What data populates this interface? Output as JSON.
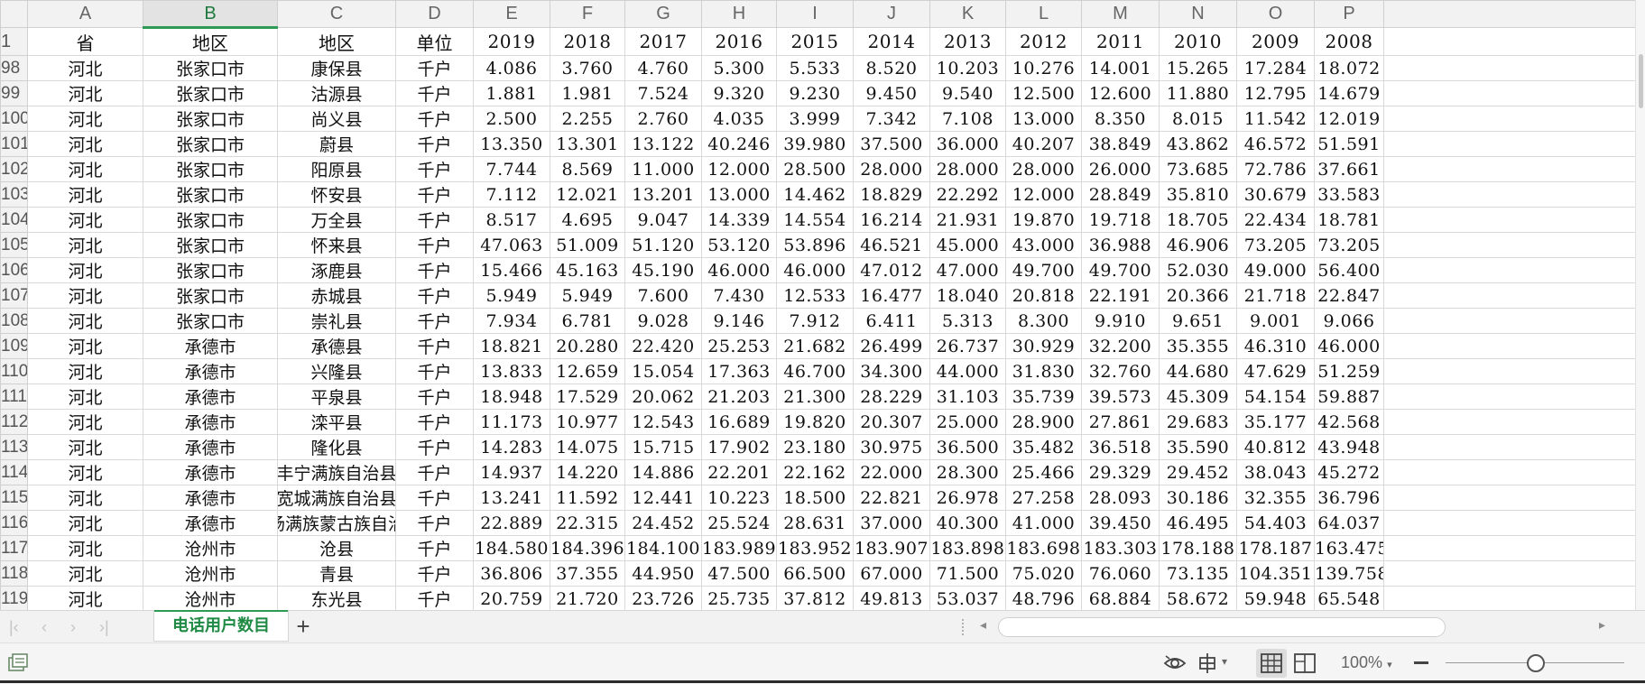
{
  "sheet": {
    "columns": [
      "A",
      "B",
      "C",
      "D",
      "E",
      "F",
      "G",
      "H",
      "I",
      "J",
      "K",
      "L",
      "M",
      "N",
      "O",
      "P"
    ],
    "active_column": "B",
    "header_row": {
      "row_number": "1",
      "cells": [
        "省",
        "地区",
        "地区",
        "单位",
        "2019",
        "2018",
        "2017",
        "2016",
        "2015",
        "2014",
        "2013",
        "2012",
        "2011",
        "2010",
        "2009",
        "2008"
      ]
    },
    "rows": [
      {
        "n": "98",
        "cells": [
          "河北",
          "张家口市",
          "康保县",
          "千户",
          "4.086",
          "3.760",
          "4.760",
          "5.300",
          "5.533",
          "8.520",
          "10.203",
          "10.276",
          "14.001",
          "15.265",
          "17.284",
          "18.072"
        ]
      },
      {
        "n": "99",
        "cells": [
          "河北",
          "张家口市",
          "沽源县",
          "千户",
          "1.881",
          "1.981",
          "7.524",
          "9.320",
          "9.230",
          "9.450",
          "9.540",
          "12.500",
          "12.600",
          "11.880",
          "12.795",
          "14.679"
        ]
      },
      {
        "n": "100",
        "cells": [
          "河北",
          "张家口市",
          "尚义县",
          "千户",
          "2.500",
          "2.255",
          "2.760",
          "4.035",
          "3.999",
          "7.342",
          "7.108",
          "13.000",
          "8.350",
          "8.015",
          "11.542",
          "12.019"
        ]
      },
      {
        "n": "101",
        "cells": [
          "河北",
          "张家口市",
          "蔚县",
          "千户",
          "13.350",
          "13.301",
          "13.122",
          "40.246",
          "39.980",
          "37.500",
          "36.000",
          "40.207",
          "38.849",
          "43.862",
          "46.572",
          "51.591"
        ]
      },
      {
        "n": "102",
        "cells": [
          "河北",
          "张家口市",
          "阳原县",
          "千户",
          "7.744",
          "8.569",
          "11.000",
          "12.000",
          "28.500",
          "28.000",
          "28.000",
          "28.000",
          "26.000",
          "73.685",
          "72.786",
          "37.661"
        ]
      },
      {
        "n": "103",
        "cells": [
          "河北",
          "张家口市",
          "怀安县",
          "千户",
          "7.112",
          "12.021",
          "13.201",
          "13.000",
          "14.462",
          "18.829",
          "22.292",
          "12.000",
          "28.849",
          "35.810",
          "30.679",
          "33.583"
        ]
      },
      {
        "n": "104",
        "cells": [
          "河北",
          "张家口市",
          "万全县",
          "千户",
          "8.517",
          "4.695",
          "9.047",
          "14.339",
          "14.554",
          "16.214",
          "21.931",
          "19.870",
          "19.718",
          "18.705",
          "22.434",
          "18.781"
        ]
      },
      {
        "n": "105",
        "cells": [
          "河北",
          "张家口市",
          "怀来县",
          "千户",
          "47.063",
          "51.009",
          "51.120",
          "53.120",
          "53.896",
          "46.521",
          "45.000",
          "43.000",
          "36.988",
          "46.906",
          "73.205",
          "73.205"
        ]
      },
      {
        "n": "106",
        "cells": [
          "河北",
          "张家口市",
          "涿鹿县",
          "千户",
          "15.466",
          "45.163",
          "45.190",
          "46.000",
          "46.000",
          "47.012",
          "47.000",
          "49.700",
          "49.700",
          "52.030",
          "49.000",
          "56.400"
        ]
      },
      {
        "n": "107",
        "cells": [
          "河北",
          "张家口市",
          "赤城县",
          "千户",
          "5.949",
          "5.949",
          "7.600",
          "7.430",
          "12.533",
          "16.477",
          "18.040",
          "20.818",
          "22.191",
          "20.366",
          "21.718",
          "22.847"
        ]
      },
      {
        "n": "108",
        "cells": [
          "河北",
          "张家口市",
          "崇礼县",
          "千户",
          "7.934",
          "6.781",
          "9.028",
          "9.146",
          "7.912",
          "6.411",
          "5.313",
          "8.300",
          "9.910",
          "9.651",
          "9.001",
          "9.066"
        ]
      },
      {
        "n": "109",
        "cells": [
          "河北",
          "承德市",
          "承德县",
          "千户",
          "18.821",
          "20.280",
          "22.420",
          "25.253",
          "21.682",
          "26.499",
          "26.737",
          "30.929",
          "32.200",
          "35.355",
          "46.310",
          "46.000"
        ]
      },
      {
        "n": "110",
        "cells": [
          "河北",
          "承德市",
          "兴隆县",
          "千户",
          "13.833",
          "12.659",
          "15.054",
          "17.363",
          "46.700",
          "34.300",
          "44.000",
          "31.830",
          "32.760",
          "44.680",
          "47.629",
          "51.259"
        ]
      },
      {
        "n": "111",
        "cells": [
          "河北",
          "承德市",
          "平泉县",
          "千户",
          "18.948",
          "17.529",
          "20.062",
          "21.203",
          "21.300",
          "28.229",
          "31.103",
          "35.739",
          "39.573",
          "45.309",
          "54.154",
          "59.887"
        ]
      },
      {
        "n": "112",
        "cells": [
          "河北",
          "承德市",
          "滦平县",
          "千户",
          "11.173",
          "10.977",
          "12.543",
          "16.689",
          "19.820",
          "20.307",
          "25.000",
          "28.900",
          "27.861",
          "29.683",
          "35.177",
          "42.568"
        ]
      },
      {
        "n": "113",
        "cells": [
          "河北",
          "承德市",
          "隆化县",
          "千户",
          "14.283",
          "14.075",
          "15.715",
          "17.902",
          "23.180",
          "30.975",
          "36.500",
          "35.482",
          "36.518",
          "35.590",
          "40.812",
          "43.948"
        ]
      },
      {
        "n": "114",
        "cells": [
          "河北",
          "承德市",
          "丰宁满族自治县",
          "千户",
          "14.937",
          "14.220",
          "14.886",
          "22.201",
          "22.162",
          "22.000",
          "28.300",
          "25.466",
          "29.329",
          "29.452",
          "38.043",
          "45.272"
        ]
      },
      {
        "n": "115",
        "cells": [
          "河北",
          "承德市",
          "宽城满族自治县",
          "千户",
          "13.241",
          "11.592",
          "12.441",
          "10.223",
          "18.500",
          "22.821",
          "26.978",
          "27.258",
          "28.093",
          "30.186",
          "32.355",
          "36.796"
        ]
      },
      {
        "n": "116",
        "cells": [
          "河北",
          "承德市",
          "场满族蒙古族自治",
          "千户",
          "22.889",
          "22.315",
          "24.452",
          "25.524",
          "28.631",
          "37.000",
          "40.300",
          "41.000",
          "39.450",
          "46.495",
          "54.403",
          "64.037"
        ]
      },
      {
        "n": "117",
        "cells": [
          "河北",
          "沧州市",
          "沧县",
          "千户",
          "184.580",
          "184.396",
          "184.100",
          "183.989",
          "183.952",
          "183.907",
          "183.898",
          "183.698",
          "183.303",
          "178.188",
          "178.187",
          "163.475"
        ]
      },
      {
        "n": "118",
        "cells": [
          "河北",
          "沧州市",
          "青县",
          "千户",
          "36.806",
          "37.355",
          "44.950",
          "47.500",
          "66.500",
          "67.000",
          "71.500",
          "75.020",
          "76.060",
          "73.135",
          "104.351",
          "139.758"
        ]
      },
      {
        "n": "119",
        "cells": [
          "河北",
          "沧州市",
          "东光县",
          "千户",
          "20.759",
          "21.720",
          "23.726",
          "25.735",
          "37.812",
          "49.813",
          "53.037",
          "48.796",
          "68.884",
          "58.672",
          "59.948",
          "65.548"
        ]
      }
    ]
  },
  "tabs": {
    "sheet_name": "电话用户数目",
    "add_label": "+"
  },
  "statusbar": {
    "zoom": "100%",
    "zoom_caret": "▾"
  },
  "icons": [
    "first-sheet-icon",
    "prev-sheet-icon",
    "next-sheet-icon",
    "last-sheet-icon",
    "eye-icon",
    "cross-icon",
    "normal-view-icon",
    "page-view-icon"
  ],
  "colors": {
    "accent": "#2e9b55",
    "tab_text": "#1f8a44",
    "header_bg": "#f2f2f2",
    "grid": "#d9d9d9"
  }
}
